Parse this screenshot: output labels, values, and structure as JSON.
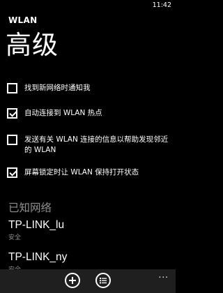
{
  "status": {
    "time": "11:42"
  },
  "app": {
    "title": "WLAN"
  },
  "page": {
    "title": "高级"
  },
  "settings": [
    {
      "label": "找到新网络时通知我",
      "checked": false
    },
    {
      "label": "自动连接到 WLAN 热点",
      "checked": true
    },
    {
      "label": "发送有关 WLAN 连接的信息以帮助发现邻近的 WLAN",
      "checked": false
    },
    {
      "label": "屏幕锁定时让 WLAN 保持打开状态",
      "checked": true
    }
  ],
  "known_networks": {
    "header": "已知网络",
    "items": [
      {
        "name": "TP-LINK_lu",
        "status": "安全"
      },
      {
        "name": "TP-LINK_ny",
        "status": "安全"
      }
    ]
  },
  "app_bar": {
    "buttons": [
      {
        "name": "add-button",
        "icon": "plus-icon"
      },
      {
        "name": "select-button",
        "icon": "list-select-icon"
      }
    ],
    "more": "..."
  }
}
